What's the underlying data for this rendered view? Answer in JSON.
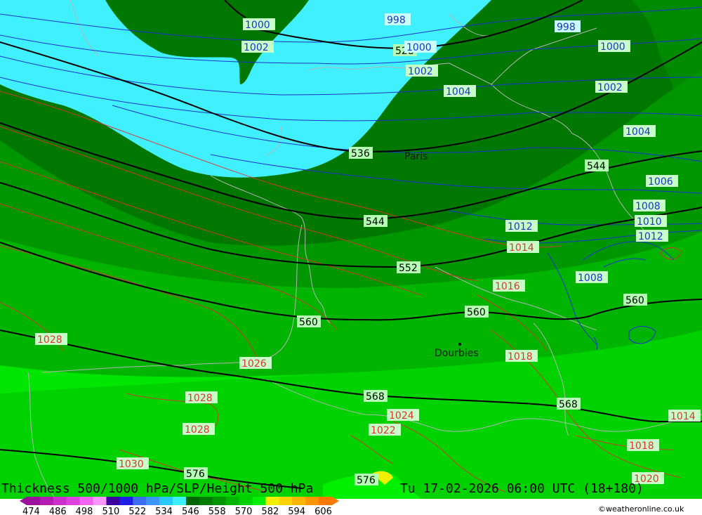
{
  "title": "Thickness 500/1000 hPa/SLP/Height 500 hPa",
  "valid_time": "Tu 17-02-2026 06:00 UTC (18+180)",
  "credit": "©weatheronline.co.uk",
  "places": [
    {
      "name": "Paris"
    },
    {
      "name": "Dourbies"
    }
  ],
  "thickness_labels": [
    "528",
    "536",
    "544",
    "552",
    "560",
    "560",
    "560",
    "568",
    "568",
    "576",
    "576"
  ],
  "slp_labels_blue": [
    "998",
    "998",
    "1000",
    "1000",
    "1000",
    "1002",
    "1002",
    "1002",
    "1004",
    "1004",
    "1006",
    "1008",
    "1010",
    "1012",
    "1012",
    "1008"
  ],
  "slp_labels_red": [
    "1014",
    "1016",
    "1018",
    "1018",
    "1028",
    "1026",
    "1028",
    "1028",
    "1030",
    "1024",
    "1022",
    "1014",
    "1020"
  ],
  "legend": {
    "ticks": [
      "474",
      "486",
      "498",
      "510",
      "522",
      "534",
      "546",
      "558",
      "570",
      "582",
      "594",
      "606"
    ],
    "colors": [
      "#9c109c",
      "#b41eb4",
      "#cc2fcc",
      "#e040e0",
      "#f064f0",
      "#ff96ff",
      "#3c00a0",
      "#1e1ee6",
      "#3c6ef0",
      "#3c96ff",
      "#28c8ff",
      "#3cf0ff",
      "#006400",
      "#007d00",
      "#009600",
      "#00b400",
      "#00d200",
      "#00f000",
      "#f0f000",
      "#ffd200",
      "#ffb400",
      "#ff9600",
      "#ff7800"
    ]
  },
  "colors": {
    "cyan": "#41f0ff",
    "dark_green": "#007800",
    "mid_green": "#009600",
    "green": "#00b400",
    "light_green": "#00d200",
    "bright_green": "#00e600",
    "thickness_line": "#000000",
    "slp_low": "#1e32d2",
    "slp_high": "#e03232",
    "coast": "#b4b4b4"
  }
}
